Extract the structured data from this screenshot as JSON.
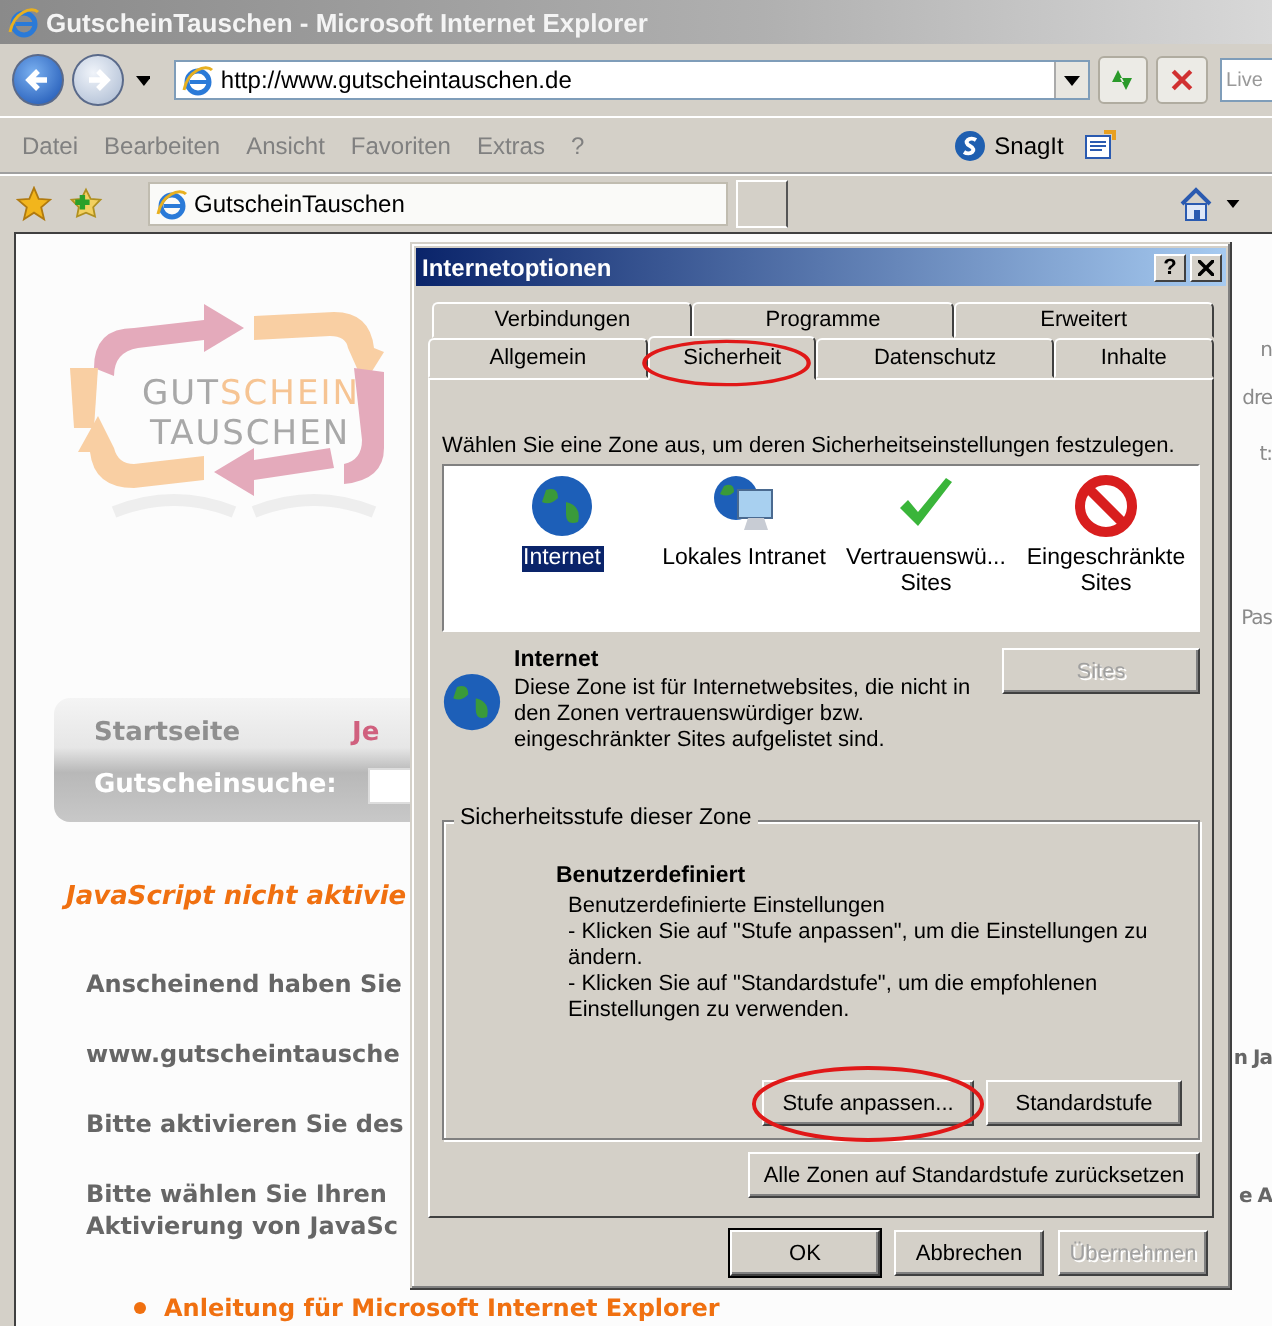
{
  "browser": {
    "title": "GutscheinTauschen - Microsoft Internet Explorer",
    "address": "http://www.gutscheintauschen.de",
    "search_placeholder": "Live",
    "menu": [
      "Datei",
      "Bearbeiten",
      "Ansicht",
      "Favoriten",
      "Extras",
      "?"
    ],
    "toolbar_label": "SnagIt",
    "tabs": [
      {
        "label": "GutscheinTauschen",
        "selected": true
      }
    ]
  },
  "page": {
    "logo_lines": [
      [
        {
          "text": "GUT",
          "color": "#a8a8a8"
        },
        {
          "text": "SCHEIN",
          "color": "#f6c493"
        }
      ],
      [
        {
          "text": "TAUSCHEN",
          "color": "#a8a8a8"
        }
      ]
    ],
    "nav": [
      {
        "label": "Startseite",
        "color": "#8f8f8f"
      },
      {
        "label": "Je",
        "color": "#d0607e"
      }
    ],
    "search_label": "Gutscheinsuche:",
    "warning": "JavaScript nicht aktivie",
    "paragraphs": [
      [
        "Anscheinend haben Sie"
      ],
      [
        "www.gutscheintausche"
      ],
      [
        "Bitte aktivieren Sie des"
      ],
      [
        "Bitte wählen Sie Ihren",
        "Aktivierung von JavaSc"
      ]
    ],
    "links": [
      "Anleitung für Microsoft Internet Explorer"
    ],
    "right_fragments": [
      {
        "text": "n",
        "kind": "light"
      },
      {
        "text": "dre",
        "kind": "light"
      },
      {
        "text": "t:",
        "kind": "light"
      },
      {
        "text": "Pas",
        "kind": "light"
      },
      {
        "text": "n Ja",
        "kind": "bold"
      },
      {
        "text": "e A",
        "kind": "bold"
      }
    ]
  },
  "dialog": {
    "title": "Internetoptionen",
    "help": "?",
    "tab_rows": [
      [
        {
          "label": "Verbindungen",
          "selected": false
        },
        {
          "label": "Programme",
          "selected": false
        },
        {
          "label": "Erweitert",
          "selected": false
        }
      ],
      [
        {
          "label": "Allgemein",
          "selected": false,
          "highlighted": false
        },
        {
          "label": "Sicherheit",
          "selected": true,
          "highlighted": true
        },
        {
          "label": "Datenschutz",
          "selected": false,
          "highlighted": false
        },
        {
          "label": "Inhalte",
          "selected": false,
          "highlighted": false
        }
      ]
    ],
    "instruction": "Wählen Sie eine Zone aus, um deren Sicherheitseinstellungen festzulegen.",
    "zones": [
      {
        "kind": "globe",
        "lines": [
          "Internet"
        ],
        "selected": true
      },
      {
        "kind": "intranet",
        "lines": [
          "Lokales Intranet"
        ],
        "selected": false
      },
      {
        "kind": "check",
        "lines": [
          "Vertrauenswü...",
          "Sites"
        ],
        "selected": false
      },
      {
        "kind": "blocked",
        "lines": [
          "Eingeschränkte",
          "Sites"
        ],
        "selected": false
      }
    ],
    "zone_info": {
      "title": "Internet",
      "description": "Diese Zone ist für Internetwebsites, die nicht in den Zonen vertrauenswürdiger bzw. eingeschränkter Sites aufgelistet sind.",
      "sites_button": {
        "label": "Sites",
        "disabled": true
      }
    },
    "security_level": {
      "legend": "Sicherheitsstufe dieser Zone",
      "name": "Benutzerdefiniert",
      "details": [
        "Benutzerdefinierte Einstellungen",
        "- Klicken Sie auf \"Stufe anpassen\", um die Einstellungen zu ändern.",
        "- Klicken Sie auf \"Standardstufe\", um die empfohlenen Einstellungen zu verwenden."
      ],
      "buttons": [
        {
          "label": "Stufe anpassen...",
          "highlighted": true
        },
        {
          "label": "Standardstufe",
          "highlighted": false
        }
      ]
    },
    "reset_button": "Alle Zonen auf Standardstufe zurücksetzen",
    "footer_buttons": [
      {
        "label": "OK",
        "kind": "default",
        "disabled": false
      },
      {
        "label": "Abbrechen",
        "kind": "normal",
        "disabled": false
      },
      {
        "label": "Übernehmen",
        "kind": "normal",
        "disabled": true
      }
    ]
  }
}
